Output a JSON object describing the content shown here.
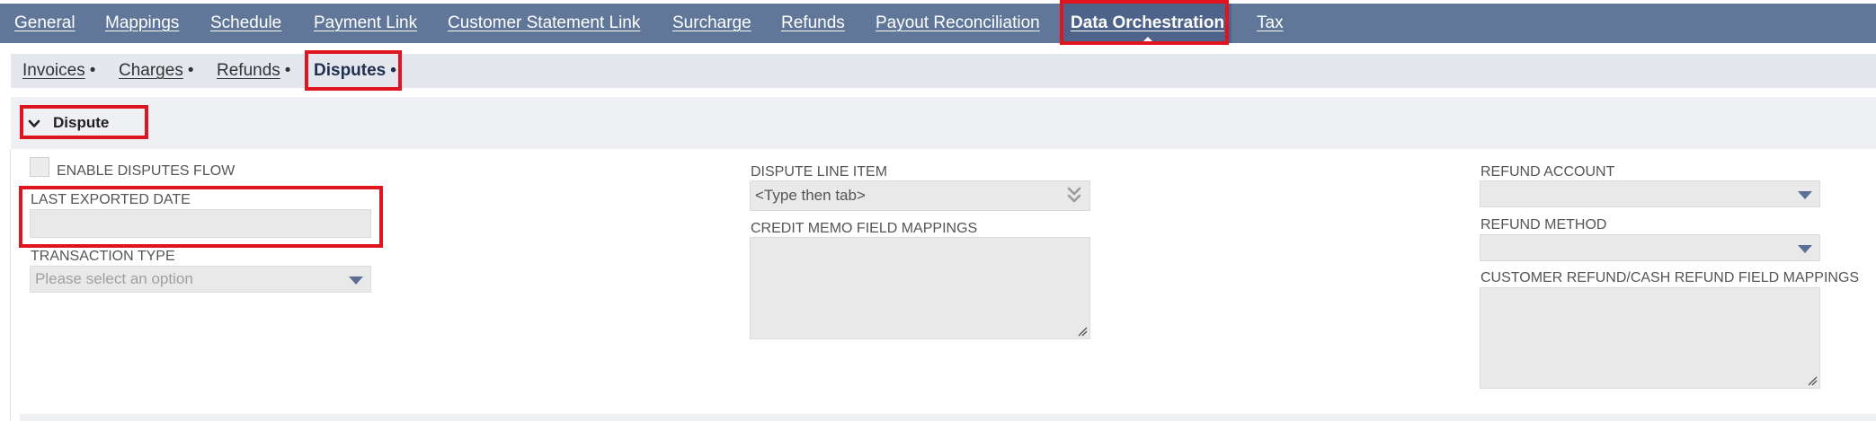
{
  "top_tabs": [
    {
      "label": "General",
      "active": false
    },
    {
      "label": "Mappings",
      "active": false
    },
    {
      "label": "Schedule",
      "active": false
    },
    {
      "label": "Payment Link",
      "active": false
    },
    {
      "label": "Customer Statement Link",
      "active": false
    },
    {
      "label": "Surcharge",
      "active": false
    },
    {
      "label": "Refunds",
      "active": false
    },
    {
      "label": "Payout Reconciliation",
      "active": false
    },
    {
      "label": "Data Orchestration",
      "active": true
    },
    {
      "label": "Tax",
      "active": false
    }
  ],
  "sub_tabs": [
    {
      "label": "Invoices",
      "active": false
    },
    {
      "label": "Charges",
      "active": false
    },
    {
      "label": "Refunds",
      "active": false
    },
    {
      "label": "Disputes",
      "active": true
    }
  ],
  "sub_tab_marker": "•",
  "section": {
    "title": "Dispute",
    "expanded": true
  },
  "fields": {
    "enable_disputes_flow": {
      "label": "ENABLE DISPUTES FLOW",
      "checked": false
    },
    "last_exported_date": {
      "label": "LAST EXPORTED DATE",
      "value": ""
    },
    "transaction_type": {
      "label": "TRANSACTION TYPE",
      "placeholder": "Please select an option"
    },
    "dispute_line_item": {
      "label": "DISPUTE LINE ITEM",
      "value": "<Type then tab>"
    },
    "credit_memo_field_mappings": {
      "label": "CREDIT MEMO FIELD MAPPINGS",
      "value": ""
    },
    "refund_account": {
      "label": "REFUND ACCOUNT",
      "value": ""
    },
    "refund_method": {
      "label": "REFUND METHOD",
      "value": ""
    },
    "customer_refund_mappings": {
      "label": "CUSTOMER REFUND/CASH REFUND FIELD MAPPINGS",
      "value": ""
    }
  },
  "icons": {
    "section_toggle": "chevron-down-icon",
    "dropdown": "caret-down-icon",
    "popup_list": "double-chevron-down-icon",
    "resize": "resize-grip-icon"
  },
  "colors": {
    "top_bar": "#607799",
    "active_top_tab": "#4d6389",
    "sub_bar": "#e4e8ee",
    "field_bg": "#e9e9e9",
    "highlight": "#e0141e",
    "dropdown_caret": "#5a6f93"
  }
}
